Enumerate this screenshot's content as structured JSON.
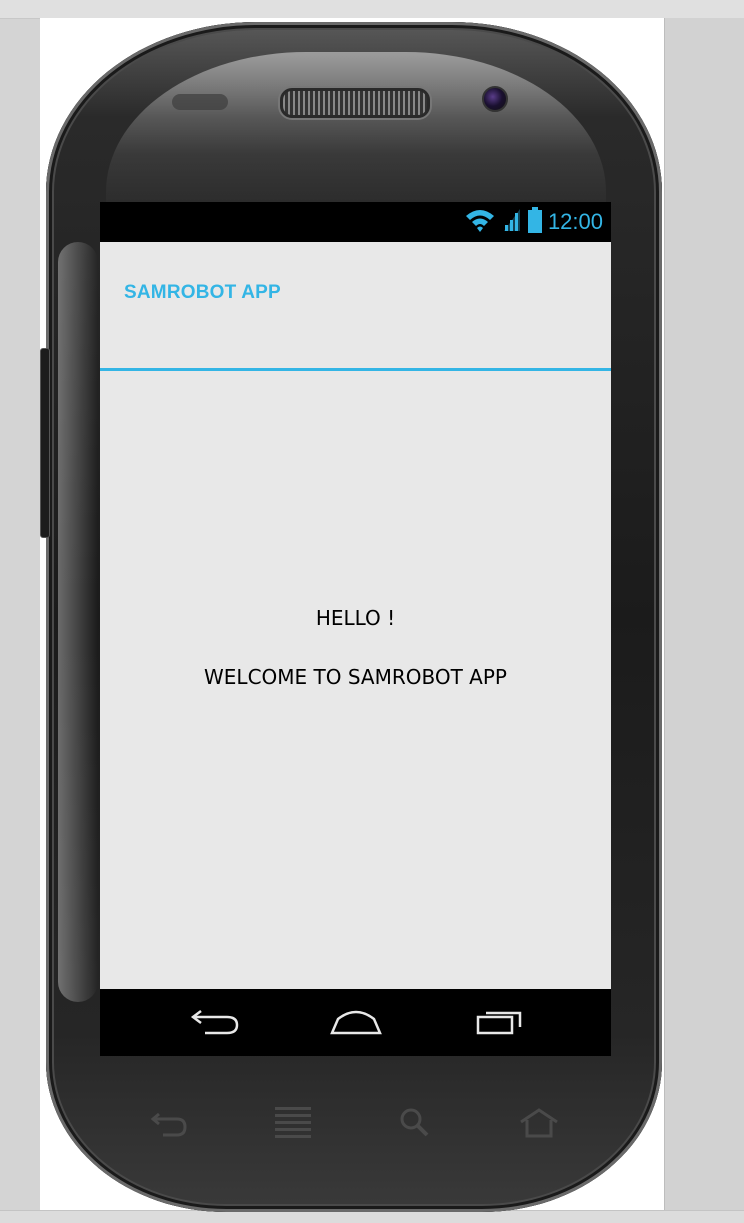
{
  "status_bar": {
    "time": "12:00",
    "icons": [
      "wifi-icon",
      "signal-icon",
      "battery-icon"
    ],
    "accent_color": "#33b5e5"
  },
  "app_bar": {
    "title": "SAMROBOT APP",
    "accent_color": "#33b5e5"
  },
  "main": {
    "greeting": "HELLO !",
    "welcome_message": "WELCOME TO SAMROBOT APP"
  },
  "nav_bar": {
    "buttons": [
      "back-icon",
      "home-icon",
      "recent-apps-icon"
    ]
  },
  "hardware_keys": [
    "back-icon",
    "menu-icon",
    "search-icon",
    "home-icon"
  ]
}
